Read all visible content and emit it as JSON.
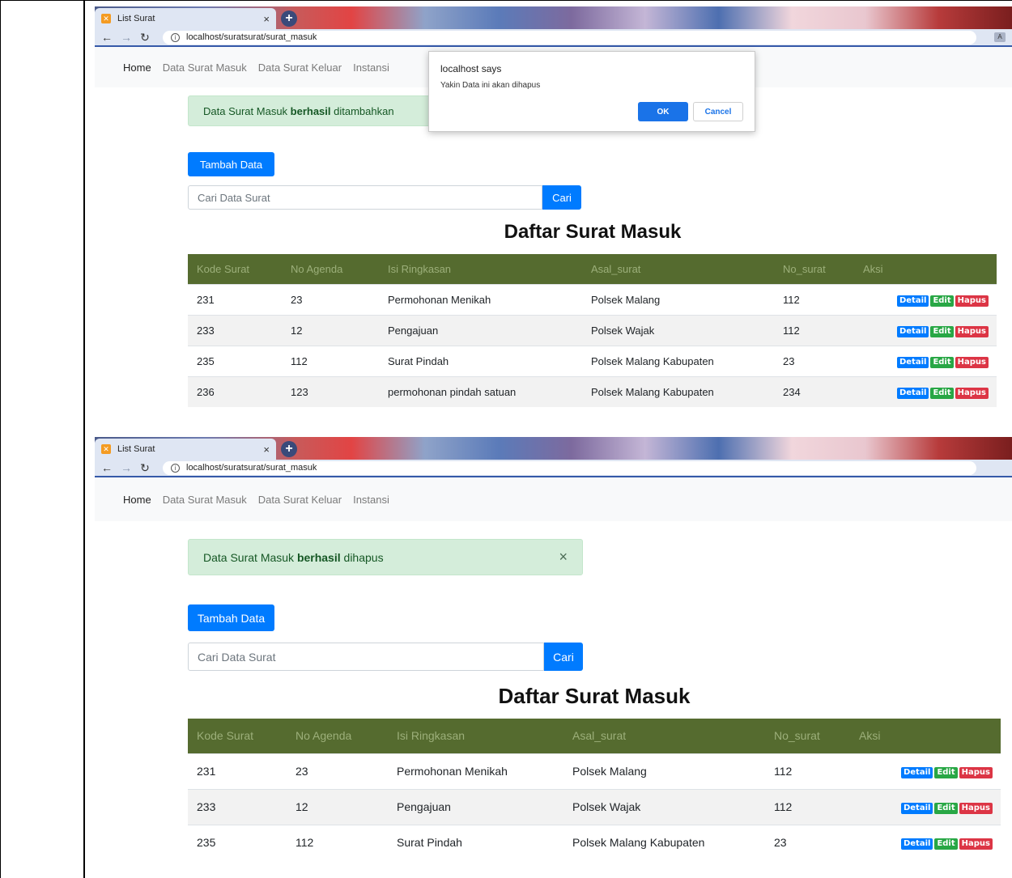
{
  "browser": {
    "tab_title": "List Surat",
    "url": "localhost/suratsurat/surat_masuk"
  },
  "nav": {
    "brand": "Home",
    "items": [
      "Data Surat Masuk",
      "Data Surat Keluar",
      "Instansi"
    ]
  },
  "dialog": {
    "title": "localhost says",
    "message": "Yakin Data ini akan dihapus",
    "ok": "OK",
    "cancel": "Cancel"
  },
  "shot1": {
    "alert_prefix": "Data Surat Masuk ",
    "alert_bold": "berhasil",
    "alert_suffix": " ditambahkan"
  },
  "shot2": {
    "alert_prefix": "Data Surat Masuk ",
    "alert_bold": "berhasil",
    "alert_suffix": " dihapus",
    "alert_close": "×"
  },
  "page": {
    "add_button": "Tambah Data",
    "search_placeholder": "Cari Data Surat",
    "search_button": "Cari",
    "title": "Daftar Surat Masuk"
  },
  "table": {
    "headers": [
      "Kode Surat",
      "No Agenda",
      "Isi Ringkasan",
      "Asal_surat",
      "No_surat",
      "Aksi"
    ],
    "actions": [
      "Detail",
      "Edit",
      "Hapus"
    ],
    "rows1": [
      [
        "231",
        "23",
        "Permohonan Menikah",
        "Polsek Malang",
        "112"
      ],
      [
        "233",
        "12",
        "Pengajuan",
        "Polsek Wajak",
        "112"
      ],
      [
        "235",
        "112",
        "Surat Pindah",
        "Polsek Malang Kabupaten",
        "23"
      ],
      [
        "236",
        "123",
        "permohonan pindah satuan",
        "Polsek Malang Kabupaten",
        "234"
      ]
    ],
    "rows2": [
      [
        "231",
        "23",
        "Permohonan Menikah",
        "Polsek Malang",
        "112"
      ],
      [
        "233",
        "12",
        "Pengajuan",
        "Polsek Wajak",
        "112"
      ],
      [
        "235",
        "112",
        "Surat Pindah",
        "Polsek Malang Kabupaten",
        "23"
      ]
    ]
  },
  "colors": {
    "table_header_bg": "#556b2f",
    "primary": "#007bff",
    "success_alert_bg": "#d4edda"
  }
}
